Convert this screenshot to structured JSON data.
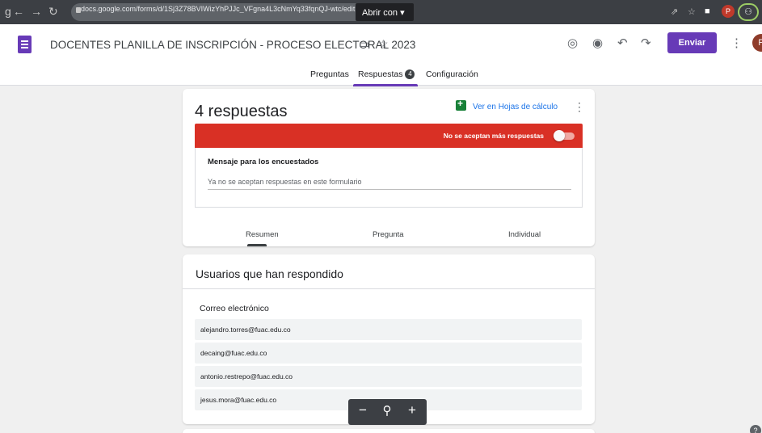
{
  "browser": {
    "url": "docs.google.com/forms/d/1Sj3Z78BVIWizYhPJJc_VFgna4L3cNmYq33fqnQJ-wtc/edit",
    "open_with": "Abrir con ▾"
  },
  "header": {
    "title": "DOCENTES PLANILLA DE INSCRIPCIÓN - PROCESO ELECTORAL 2023",
    "send_label": "Enviar",
    "avatar_letter": "P"
  },
  "tabs": [
    {
      "label": "Preguntas"
    },
    {
      "label": "Respuestas",
      "badge": "4"
    },
    {
      "label": "Configuración"
    }
  ],
  "responses": {
    "count_label": "4 respuestas",
    "sheets_link": "Ver en Hojas de cálculo",
    "accepting_label": "No se aceptan más respuestas",
    "accepting": false,
    "message_title": "Mensaje para los encuestados",
    "message_text": "Ya no se aceptan respuestas en este formulario",
    "sub_tabs": [
      "Resumen",
      "Pregunta",
      "Individual"
    ]
  },
  "users": {
    "title": "Usuarios que han respondido",
    "column_header": "Correo electrónico",
    "emails": [
      "alejandro.torres@fuac.edu.co",
      "decaing@fuac.edu.co",
      "antonio.restrepo@fuac.edu.co",
      "jesus.mora@fuac.edu.co"
    ]
  },
  "zoom": {
    "minus": "−",
    "search": "⚲",
    "plus": "+"
  },
  "colors": {
    "accent": "#673ab7",
    "closed_banner": "#d93025",
    "sheets_green": "#188038",
    "link_blue": "#1a73e8"
  },
  "icons": [
    "back-icon",
    "forward-icon",
    "reload-icon",
    "lock-icon",
    "share-icon",
    "star-icon",
    "extensions-icon",
    "forms-logo-icon",
    "folder-icon",
    "star-outline-icon",
    "palette-icon",
    "preview-eye-icon",
    "undo-icon",
    "redo-icon",
    "more-vert-icon",
    "sheets-icon",
    "zoom-out-icon",
    "zoom-search-icon",
    "zoom-in-icon",
    "help-icon"
  ]
}
